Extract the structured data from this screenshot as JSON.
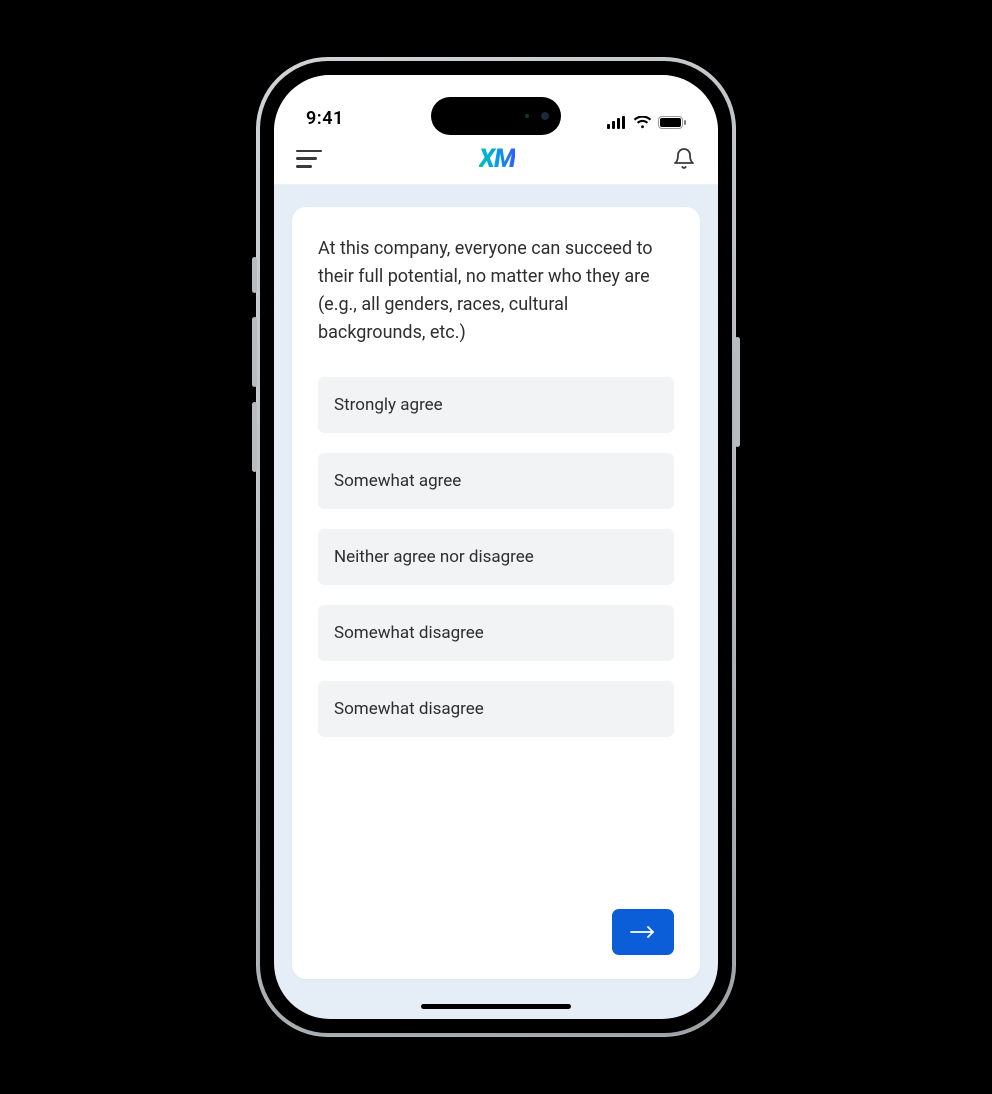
{
  "status": {
    "time": "9:41"
  },
  "header": {
    "logo_text": "XM"
  },
  "survey": {
    "question": "At this company, everyone can succeed to their full potential, no matter who they are (e.g., all genders, races, cultural backgrounds, etc.)",
    "options": [
      "Strongly agree",
      "Somewhat agree",
      "Neither agree nor disagree",
      "Somewhat disagree",
      "Somewhat disagree"
    ]
  }
}
